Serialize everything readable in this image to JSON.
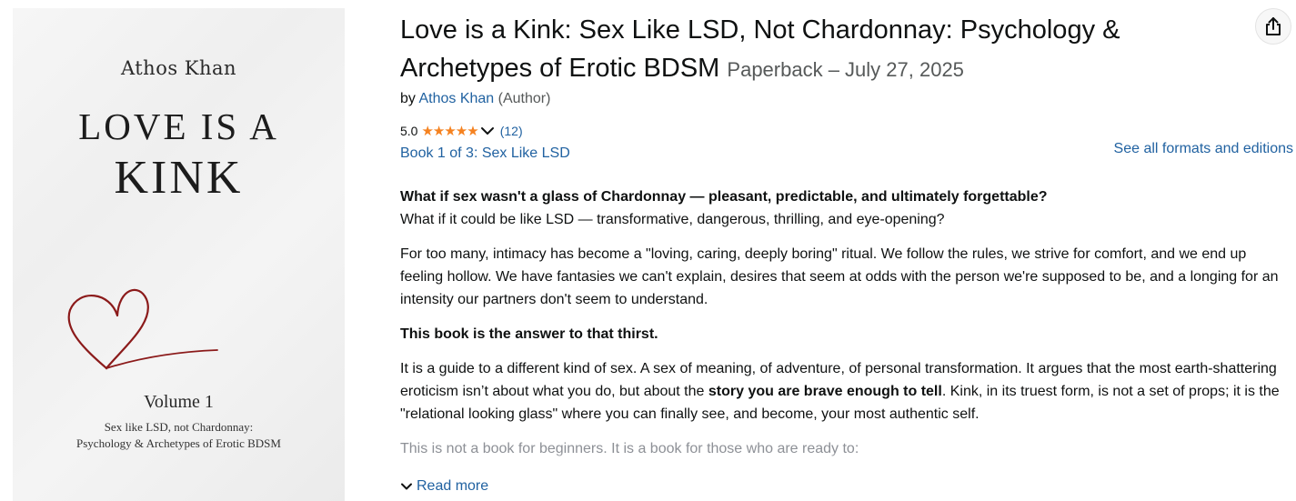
{
  "cover": {
    "author": "Athos Khan",
    "title_line1": "LOVE IS A",
    "title_line2": "KINK",
    "volume": "Volume 1",
    "subtitle_line1": "Sex like LSD, not Chardonnay:",
    "subtitle_line2": "Psychology & Archetypes of Erotic BDSM",
    "heart_color": "#8b1a1a"
  },
  "product": {
    "title_main": "Love is a Kink: Sex Like LSD, Not Chardonnay: Psychology & Archetypes of Erotic BDSM",
    "binding": "Paperback – July 27, 2025",
    "by": "by",
    "author": "Athos Khan",
    "author_role": "(Author)",
    "rating_value": "5.0",
    "rating_count": "(12)",
    "stars_filled": 5,
    "series": "Book 1 of 3: Sex Like LSD",
    "formats_link": "See all formats and editions"
  },
  "description": {
    "q1_bold": "What if sex wasn't a glass of Chardonnay — pleasant, predictable, and ultimately forgettable?",
    "q2": "What if it could be like LSD — transformative, dangerous, thrilling, and eye-opening?",
    "p2": "For too many, intimacy has become a \"loving, caring, deeply boring\" ritual. We follow the rules, we strive for comfort, and we end up feeling hollow. We have fantasies we can't explain, desires that seem at odds with the person we're supposed to be, and a longing for an intensity our partners don't seem to understand.",
    "p3_bold": "This book is the answer to that thirst.",
    "p4_a": "It is a guide to a different kind of sex. A sex of meaning, of adventure, of personal transformation. It argues that the most earth-shattering eroticism isn’t about what you do, but about the ",
    "p4_bold": "story you are brave enough to tell",
    "p4_b": ". Kink, in its truest form, is not a set of props; it is the \"relational looking glass\" where you can finally see, and become, your most authentic self.",
    "p5_faded": "This is not a book for beginners. It is a book for those who are ready to:",
    "read_more": "Read more"
  },
  "colors": {
    "link": "#2162a1",
    "star": "#f58220",
    "text": "#0f1111",
    "muted": "#565959"
  },
  "icons": {
    "share": "share-icon",
    "rating_dropdown": "chevron-down-icon",
    "read_more": "chevron-down-icon"
  }
}
